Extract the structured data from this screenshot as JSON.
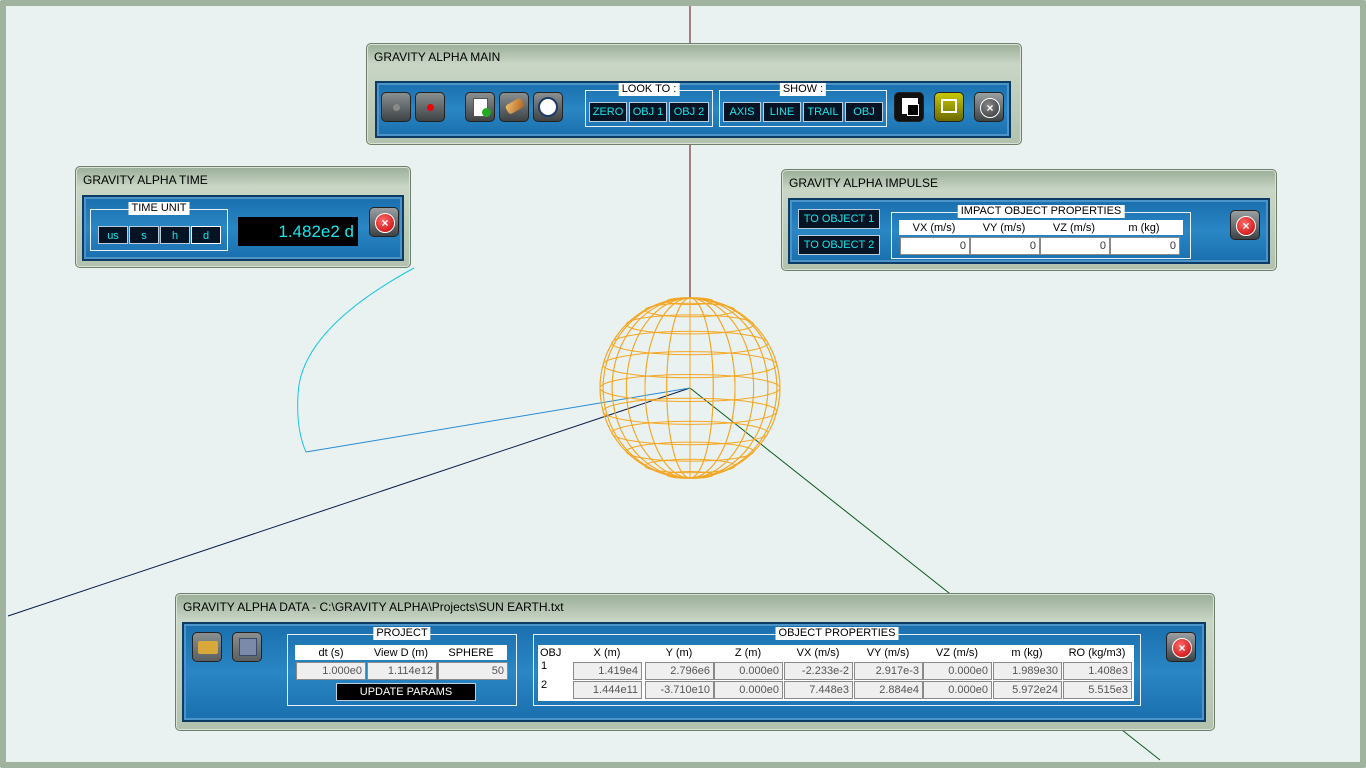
{
  "main": {
    "title": "GRAVITY ALPHA MAIN",
    "look_to": {
      "label": "LOOK TO :",
      "buttons": [
        "ZERO",
        "OBJ 1",
        "OBJ 2"
      ]
    },
    "show": {
      "label": "SHOW :",
      "buttons": [
        "AXIS",
        "LINE",
        "TRAIL",
        "OBJ"
      ]
    }
  },
  "time": {
    "title": "GRAVITY ALPHA TIME",
    "unit_label": "TIME UNIT",
    "units": [
      "us",
      "s",
      "h",
      "d"
    ],
    "selected_unit": "d",
    "display": "1.482e2 d"
  },
  "impulse": {
    "title": "GRAVITY ALPHA IMPULSE",
    "buttons": [
      "TO OBJECT 1",
      "TO OBJECT 2"
    ],
    "props_label": "IMPACT OBJECT PROPERTIES",
    "headers": [
      "VX (m/s)",
      "VY (m/s)",
      "VZ (m/s)",
      "m (kg)"
    ],
    "values": [
      "0",
      "0",
      "0",
      "0"
    ]
  },
  "data": {
    "title": "GRAVITY ALPHA DATA - C:\\GRAVITY ALPHA\\Projects\\SUN EARTH.txt",
    "project": {
      "label": "PROJECT",
      "headers": [
        "dt (s)",
        "View D (m)",
        "SPHERE"
      ],
      "values": [
        "1.000e0",
        "1.114e12",
        "50"
      ],
      "update_label": "UPDATE PARAMS"
    },
    "object_props": {
      "label": "OBJECT PROPERTIES",
      "headers": [
        "OBJ",
        "X (m)",
        "Y (m)",
        "Z (m)",
        "VX (m/s)",
        "VY (m/s)",
        "VZ (m/s)",
        "m (kg)",
        "RO (kg/m3)"
      ],
      "rows": [
        {
          "id": "1",
          "values": [
            "1.419e4",
            "2.796e6",
            "0.000e0",
            "-2.233e-2",
            "2.917e-3",
            "0.000e0",
            "1.989e30",
            "1.408e3"
          ]
        },
        {
          "id": "2",
          "values": [
            "1.444e11",
            "-3.710e10",
            "0.000e0",
            "7.448e3",
            "2.884e4",
            "0.000e0",
            "5.972e24",
            "5.515e3"
          ]
        }
      ]
    }
  },
  "colors": {
    "sphere": "#f5a623",
    "trail": "#16c8e0",
    "panel_blue": "#1a6fae",
    "display_text": "#19e5ea"
  }
}
